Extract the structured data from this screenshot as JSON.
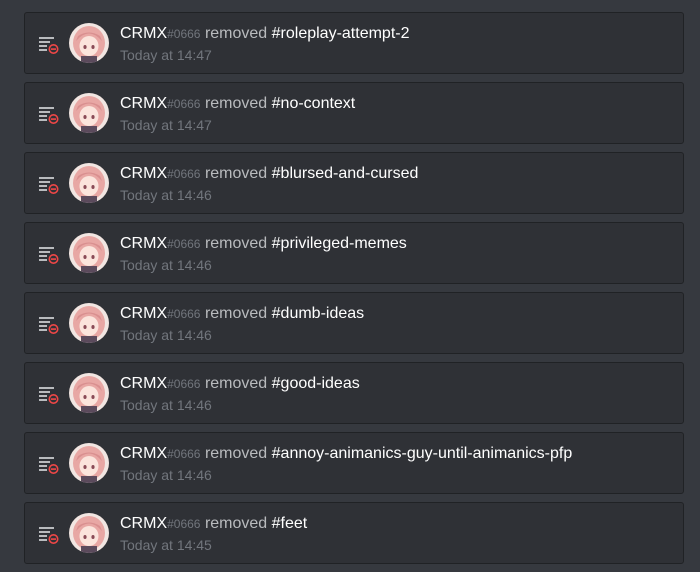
{
  "entries": [
    {
      "username": "CRMX",
      "discriminator": "#0666",
      "action": "removed",
      "channel": "#roleplay-attempt-2",
      "timestamp": "Today at 14:47"
    },
    {
      "username": "CRMX",
      "discriminator": "#0666",
      "action": "removed",
      "channel": "#no-context",
      "timestamp": "Today at 14:47"
    },
    {
      "username": "CRMX",
      "discriminator": "#0666",
      "action": "removed",
      "channel": "#blursed-and-cursed",
      "timestamp": "Today at 14:46"
    },
    {
      "username": "CRMX",
      "discriminator": "#0666",
      "action": "removed",
      "channel": "#privileged-memes",
      "timestamp": "Today at 14:46"
    },
    {
      "username": "CRMX",
      "discriminator": "#0666",
      "action": "removed",
      "channel": "#dumb-ideas",
      "timestamp": "Today at 14:46"
    },
    {
      "username": "CRMX",
      "discriminator": "#0666",
      "action": "removed",
      "channel": "#good-ideas",
      "timestamp": "Today at 14:46"
    },
    {
      "username": "CRMX",
      "discriminator": "#0666",
      "action": "removed",
      "channel": "#annoy-animanics-guy-until-animanics-pfp",
      "timestamp": "Today at 14:46"
    },
    {
      "username": "CRMX",
      "discriminator": "#0666",
      "action": "removed",
      "channel": "#feet",
      "timestamp": "Today at 14:45"
    }
  ],
  "icons": {
    "action_icon": "channel-delete-icon",
    "avatar": "anime-avatar"
  },
  "colors": {
    "background": "#36393f",
    "entry_background": "#2f3136",
    "delete_red": "#f04747",
    "username": "#ffffff",
    "muted_text": "#72767d"
  }
}
